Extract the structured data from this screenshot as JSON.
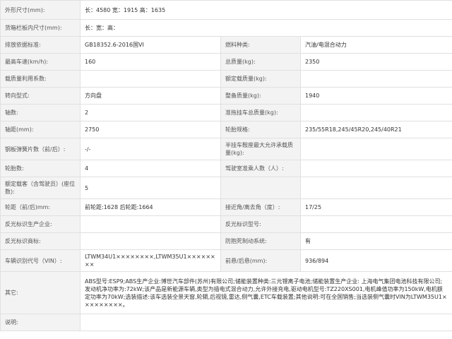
{
  "rows": [
    {
      "l1": "外形尺寸(mm):",
      "v_span": "长：4580 宽：1915 高：1635"
    },
    {
      "l1": "货箱栏板内尺寸(mm):",
      "v_span": "长：宽：高："
    },
    {
      "l1": "排放依据标准:",
      "v1": "GB18352.6-2016国VI",
      "l2": "燃料种类:",
      "v2": "汽油/电混合动力"
    },
    {
      "l1": "最高车速(km/h):",
      "v1": "160",
      "l2": "总质量(kg):",
      "v2": "2350"
    },
    {
      "l1": "载质量利用系数:",
      "v1": "",
      "l2": "额定载质量(kg):",
      "v2": ""
    },
    {
      "l1": "转向型式:",
      "v1": "方向盘",
      "l2": "整备质量(kg):",
      "v2": "1940"
    },
    {
      "l1": "轴数:",
      "v1": "2",
      "l2": "准拖挂车总质量(kg):",
      "v2": ""
    },
    {
      "l1": "轴距(mm):",
      "v1": "2750",
      "l2": "轮胎规格:",
      "v2": "235/55R18,245/45R20,245/40R21"
    },
    {
      "l1": "钢板弹簧片数（前/后）:",
      "v1": "-/-",
      "l2": "半挂车鞍座最大允许承载质量(kg):",
      "v2": ""
    },
    {
      "l1": "轮胎数:",
      "v1": "4",
      "l2": "驾驶室准乘人数（人）:",
      "v2": ""
    },
    {
      "l1": "额定载客（含驾驶员）(座位数):",
      "v1": "5",
      "l2": "",
      "v2": ""
    },
    {
      "l1": "轮距（前/后)mm:",
      "v1": "前轮距:1628 后轮距:1664",
      "l2": "接近角/离去角（度）:",
      "v2": "17/25"
    },
    {
      "l1": "反光标识生产企业:",
      "v1": "",
      "l2": "反光标识型号:",
      "v2": ""
    },
    {
      "l1": "反光标识商标:",
      "v1": "",
      "l2": "防抱死制动系统:",
      "v2": "有"
    },
    {
      "l1": "车辆识别代号（VIN）:",
      "v1": "LTWM34U1××××××××,LTWM35U1××××××××",
      "l2": "前悬/后悬(mm):",
      "v2": "936/894"
    },
    {
      "l1": "其它:",
      "v_span": "ABS型号:ESP9;ABS生产企业:博世汽车部件(苏州)有限公司;储能装置种类:三元锂离子电池;储能装置生产企业: 上海电气集团电池科技有限公司; 发动机净功率为:72kW;该产品是新能源车辆,类型为插电式混合动力,允许外接充电,驱动电机型号:TZ220XS001,电机峰值功率为150kW,电机额定功率为70kW;选装描述:该车选装全景天窗,轮辋,后视镜,雷达,侧气囊,ETC车载装置;其他说明:可在全国销售;当选装侧气囊时VIN为LTWM35U1×××××××××。"
    },
    {
      "l1": "说明:",
      "v_span": ""
    }
  ]
}
